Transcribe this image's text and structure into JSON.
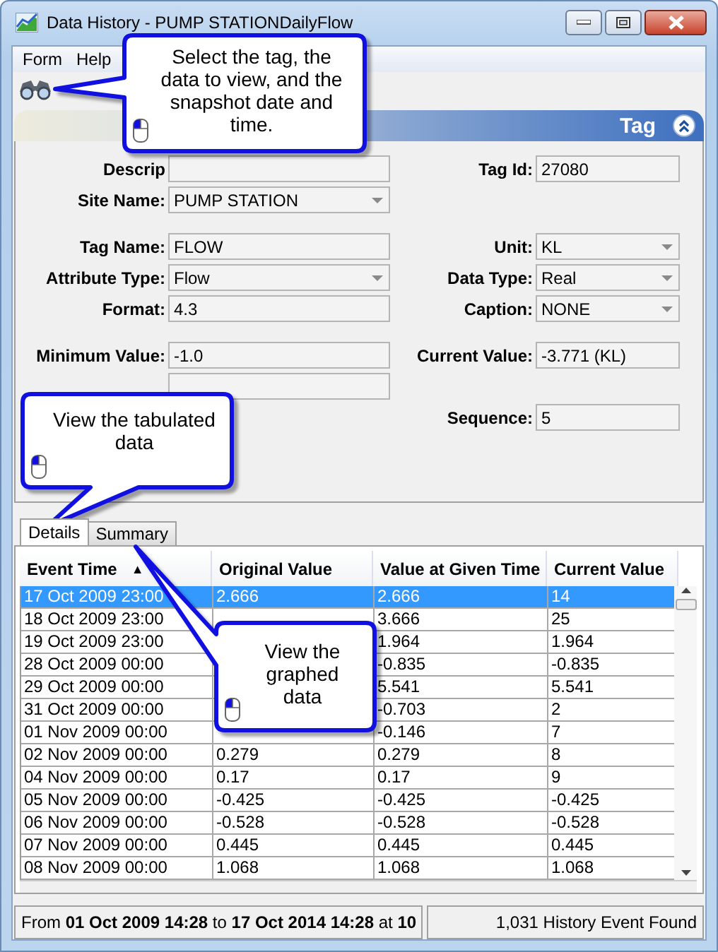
{
  "window": {
    "title": "Data History - PUMP STATIONDailyFlow"
  },
  "menu": [
    "Form",
    "Help"
  ],
  "section_header": {
    "title": "Tag",
    "expanded": true
  },
  "form_groups": [
    [
      {
        "left": {
          "label": "Descrip",
          "kind": "text"
        },
        "right": {
          "label": "Tag Id:",
          "kind": "text",
          "value": "27080"
        }
      },
      {
        "left": {
          "label": "Site Name:",
          "kind": "combo",
          "value": "PUMP STATION"
        }
      }
    ],
    [
      {
        "left": {
          "label": "Tag Name:",
          "kind": "text",
          "value": "FLOW"
        },
        "right": {
          "label": "Unit:",
          "kind": "combo",
          "value": "KL"
        }
      },
      {
        "left": {
          "label": "Attribute Type:",
          "kind": "combo",
          "value": "Flow"
        },
        "right": {
          "label": "Data Type:",
          "kind": "combo",
          "value": "Real"
        }
      },
      {
        "left": {
          "label": "Format:",
          "kind": "text",
          "value": "4.3"
        },
        "right": {
          "label": "Caption:",
          "kind": "combo",
          "value": "NONE"
        }
      }
    ],
    [
      {
        "left": {
          "label": "Minimum Value:",
          "kind": "text",
          "value": "-1.0"
        },
        "right": {
          "label": "Current Value:",
          "kind": "text",
          "value": "-3.771 (KL)"
        }
      },
      {
        "left": {
          "kind": "text"
        }
      },
      {
        "right": {
          "label": "Sequence:",
          "kind": "text",
          "value": "5"
        }
      }
    ]
  ],
  "tabs": [
    {
      "label": "Details",
      "selected": true
    },
    {
      "label": "Summary",
      "selected": false
    }
  ],
  "table": {
    "columns": [
      {
        "label": "Event Time",
        "sort_indicator": "▲"
      },
      {
        "label": "Original Value"
      },
      {
        "label": "Value at Given Time"
      },
      {
        "label": "Current Value"
      }
    ],
    "rows": [
      {
        "event_time": "17 Oct 2009 23:00",
        "original_value": "2.666",
        "value_at_given_time": "2.666",
        "current_value": "14",
        "selected": true
      },
      {
        "event_time": "18 Oct 2009 23:00",
        "value_at_given_time": "3.666",
        "current_value": "25",
        "selected": false
      },
      {
        "event_time": "19 Oct 2009 23:00",
        "value_at_given_time": "1.964",
        "current_value": "1.964",
        "selected": false
      },
      {
        "event_time": "28 Oct 2009 00:00",
        "value_at_given_time": "-0.835",
        "current_value": "-0.835",
        "selected": false
      },
      {
        "event_time": "29 Oct 2009 00:00",
        "value_at_given_time": "5.541",
        "current_value": "5.541",
        "selected": false
      },
      {
        "event_time": "31 Oct 2009 00:00",
        "value_at_given_time": "-0.703",
        "current_value": "2",
        "selected": false
      },
      {
        "event_time": "01 Nov 2009 00:00",
        "value_at_given_time": "-0.146",
        "current_value": "7",
        "selected": false
      },
      {
        "event_time": "02 Nov 2009 00:00",
        "original_value": "0.279",
        "value_at_given_time": "0.279",
        "current_value": "8",
        "selected": false
      },
      {
        "event_time": "04 Nov 2009 00:00",
        "original_value": "0.17",
        "value_at_given_time": "0.17",
        "current_value": "9",
        "selected": false
      },
      {
        "event_time": "05 Nov 2009 00:00",
        "original_value": "-0.425",
        "value_at_given_time": "-0.425",
        "current_value": "-0.425",
        "selected": false
      },
      {
        "event_time": "06 Nov 2009 00:00",
        "original_value": "-0.528",
        "value_at_given_time": "-0.528",
        "current_value": "-0.528",
        "selected": false
      },
      {
        "event_time": "07 Nov 2009 00:00",
        "original_value": "0.445",
        "value_at_given_time": "0.445",
        "current_value": "0.445",
        "selected": false
      },
      {
        "event_time": "08 Nov 2009 00:00",
        "original_value": "1.068",
        "value_at_given_time": "1.068",
        "current_value": "1.068",
        "selected": false
      }
    ]
  },
  "status_bar": {
    "range": "From **01 Oct 2009 14:28** to **17 Oct 2014 14:28** at **10**",
    "count": "1,031 History Event Found"
  },
  "callouts": [
    {
      "text": "Select the tag, the data to view, and the snapshot date and time."
    },
    {
      "text": "View the tabulated data"
    },
    {
      "text": "View the graphed data"
    }
  ]
}
